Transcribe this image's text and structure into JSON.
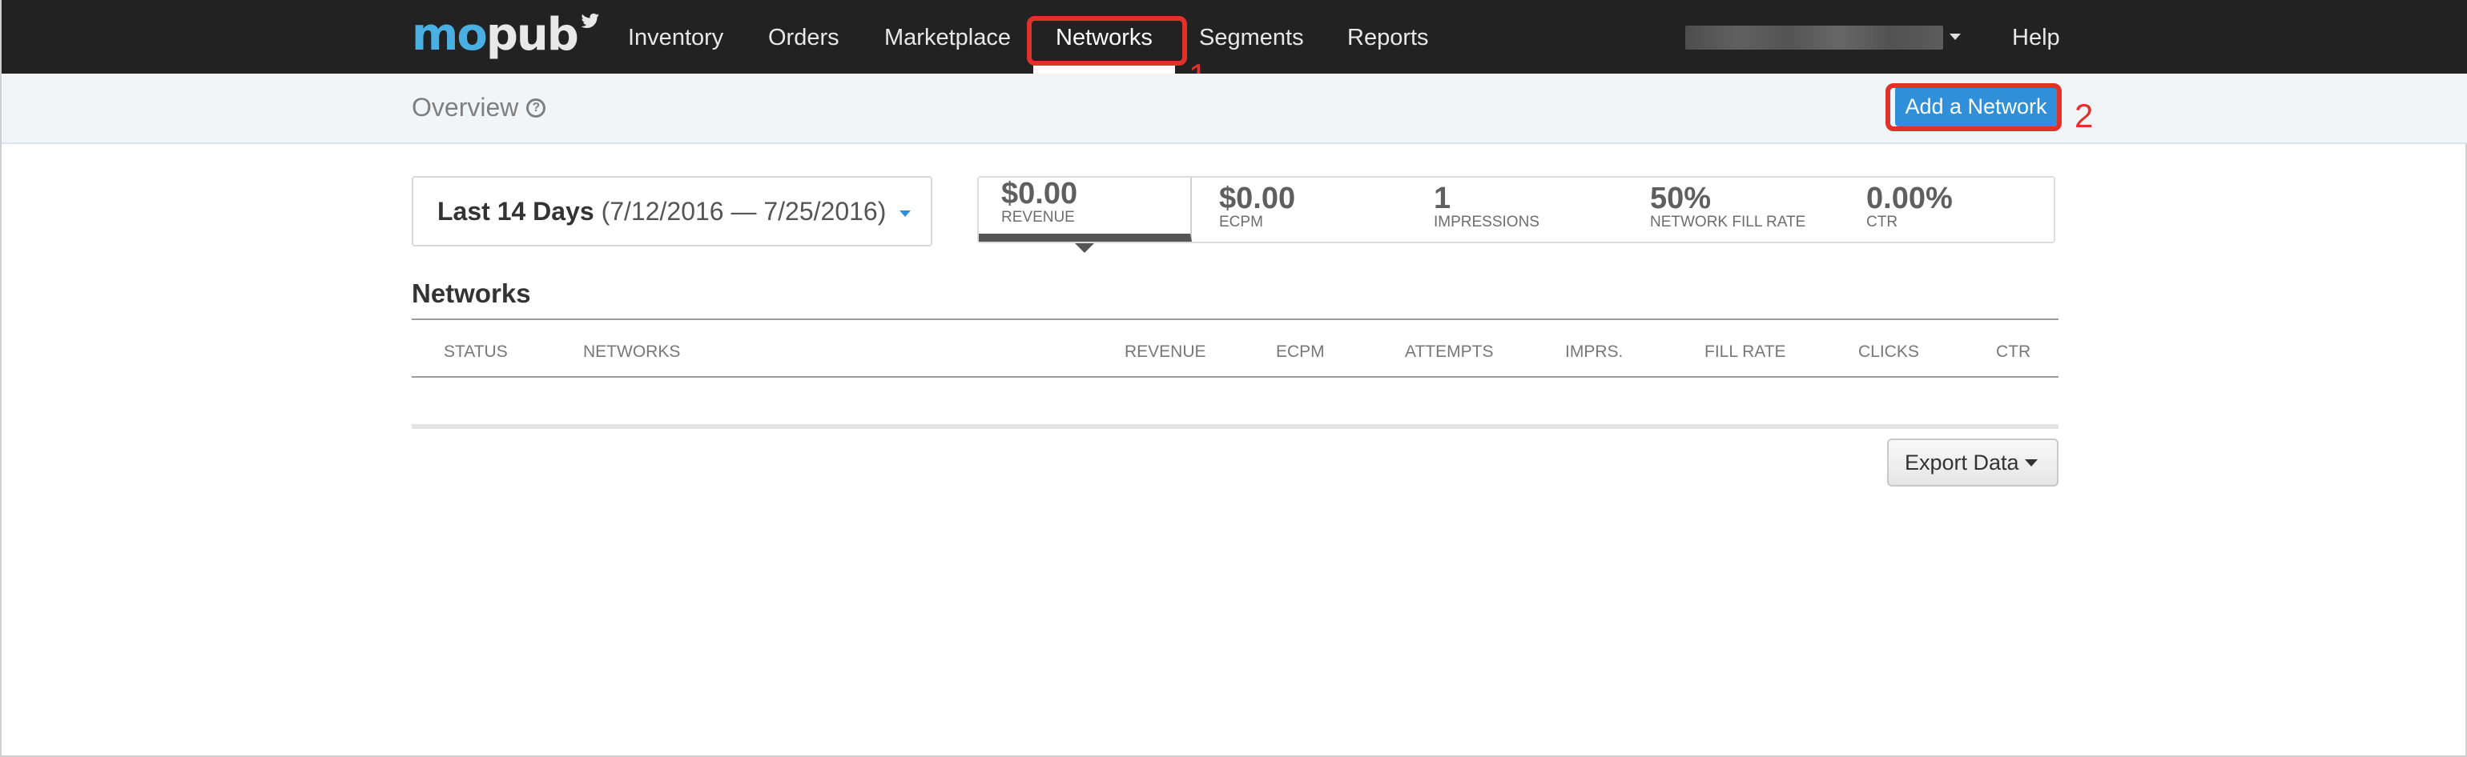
{
  "nav": {
    "logo_mo": "mo",
    "logo_pub": "pub",
    "items": [
      "Inventory",
      "Orders",
      "Marketplace",
      "Networks",
      "Segments",
      "Reports"
    ],
    "active": "Networks",
    "help": "Help"
  },
  "annotations": {
    "step1": "1",
    "step2": "2",
    "color": "#e2302b"
  },
  "subheader": {
    "title": "Overview",
    "help_glyph": "?",
    "add_button": "Add a Network"
  },
  "date_picker": {
    "label": "Last 14 Days",
    "range": "(7/12/2016 — 7/25/2016)"
  },
  "stats": [
    {
      "value": "$0.00",
      "label": "REVENUE"
    },
    {
      "value": "$0.00",
      "label": "ECPM"
    },
    {
      "value": "1",
      "label": "IMPRESSIONS"
    },
    {
      "value": "50%",
      "label": "NETWORK FILL RATE"
    },
    {
      "value": "0.00%",
      "label": "CTR"
    }
  ],
  "networks": {
    "title": "Networks",
    "columns": [
      "STATUS",
      "NETWORKS",
      "REVENUE",
      "ECPM",
      "ATTEMPTS",
      "IMPRS.",
      "FILL RATE",
      "CLICKS",
      "CTR"
    ],
    "rows": []
  },
  "export": {
    "label": "Export Data"
  },
  "colors": {
    "nav_bg": "#222222",
    "accent": "#2f8fd8",
    "logo_blue": "#4ab0e3"
  }
}
